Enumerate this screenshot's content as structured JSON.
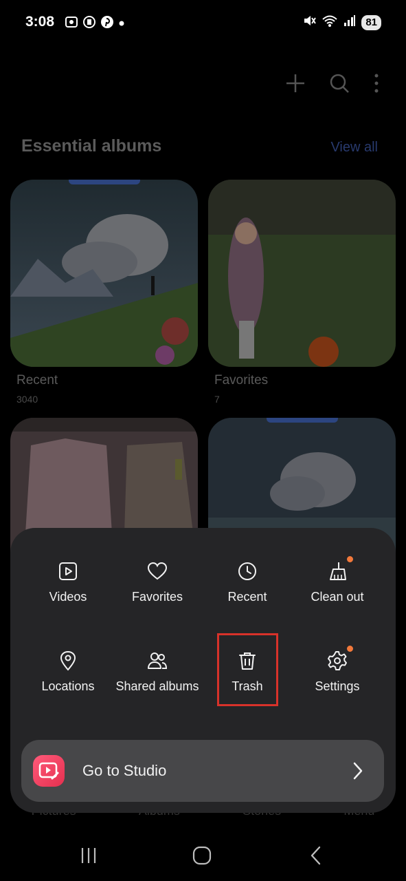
{
  "status_bar": {
    "time": "3:08",
    "battery": "81"
  },
  "header": {
    "section_title": "Essential albums",
    "view_all_label": "View all"
  },
  "albums": [
    {
      "name": "Recent",
      "count": "3040"
    },
    {
      "name": "Favorites",
      "count": "7"
    }
  ],
  "bottom_tabs": [
    "Pictures",
    "Albums",
    "Stories",
    "Menu"
  ],
  "menu": {
    "items": [
      {
        "label": "Videos",
        "icon": "video-icon"
      },
      {
        "label": "Favorites",
        "icon": "heart-icon"
      },
      {
        "label": "Recent",
        "icon": "clock-icon"
      },
      {
        "label": "Clean out",
        "icon": "broom-icon",
        "badge": true
      },
      {
        "label": "Locations",
        "icon": "location-pin-icon"
      },
      {
        "label": "Shared albums",
        "icon": "people-icon"
      },
      {
        "label": "Trash",
        "icon": "trash-icon"
      },
      {
        "label": "Settings",
        "icon": "gear-icon",
        "badge": true
      }
    ],
    "studio_label": "Go to Studio"
  },
  "colors": {
    "sheet_bg": "#252527",
    "studio_bar_bg": "#474749",
    "badge": "#f2793b",
    "highlight": "#d8322a"
  }
}
